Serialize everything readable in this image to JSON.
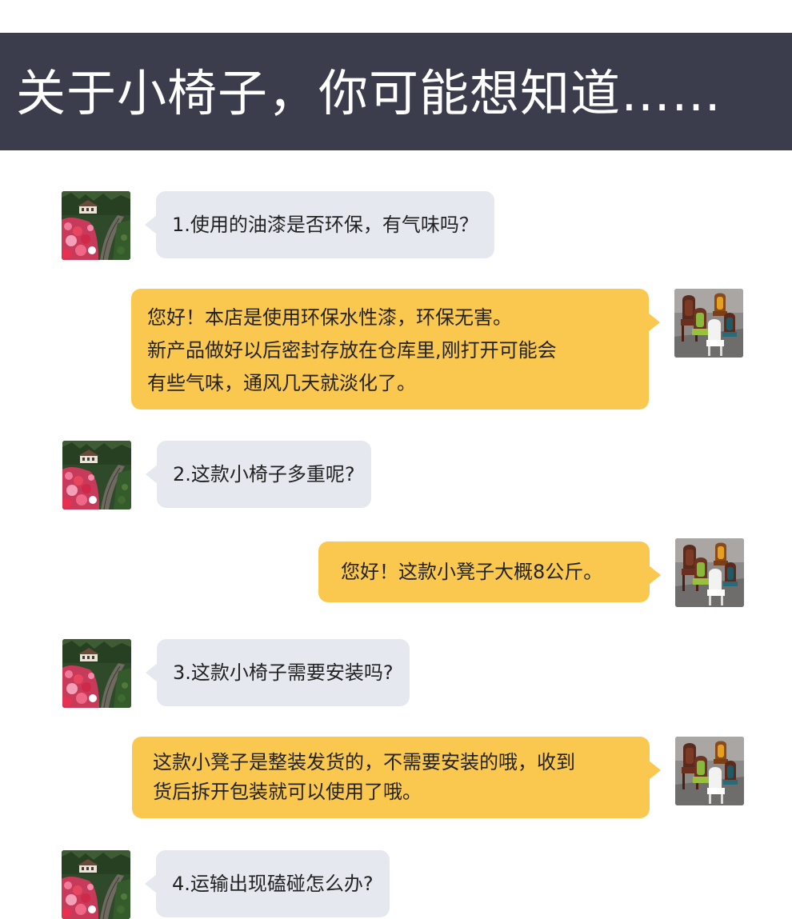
{
  "header": {
    "title": "关于小椅子，你可能想知道……"
  },
  "conversation": [
    {
      "role": "customer",
      "avatar": "garden-flowers-avatar",
      "text": "1.使用的油漆是否环保，有气味吗？"
    },
    {
      "role": "shop",
      "avatar": "chairs-avatar",
      "lines": [
        "您好！本店是使用环保水性漆，环保无害。",
        "新产品做好以后密封存放在仓库里,刚打开可能会",
        "有些气味，通风几天就淡化了。"
      ]
    },
    {
      "role": "customer",
      "avatar": "garden-flowers-avatar",
      "text": "2.这款小椅子多重呢?"
    },
    {
      "role": "shop",
      "avatar": "chairs-avatar",
      "lines": [
        "您好！这款小凳子大概8公斤。"
      ]
    },
    {
      "role": "customer",
      "avatar": "garden-flowers-avatar",
      "text": "3.这款小椅子需要安装吗?"
    },
    {
      "role": "shop",
      "avatar": "chairs-avatar",
      "lines": [
        "这款小凳子是整装发货的，不需要安装的哦，收到",
        "货后拆开包装就可以使用了哦。"
      ]
    },
    {
      "role": "customer",
      "avatar": "garden-flowers-avatar",
      "text": "4.运输出现磕碰怎么办?"
    }
  ],
  "colors": {
    "header_bg": "#3b3d4c",
    "question_bubble": "#e5e8ef",
    "answer_bubble": "#fac84f"
  }
}
